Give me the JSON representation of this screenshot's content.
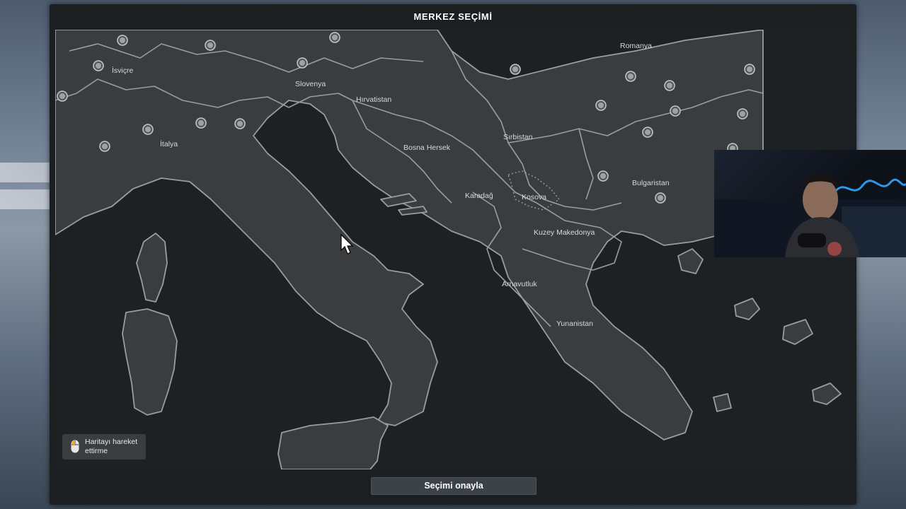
{
  "dialog": {
    "title": "MERKEZ SEÇİMİ",
    "confirm_label": "Seçimi onayla"
  },
  "hint": {
    "text": "Haritayı hareket ettirme",
    "icon": "mouse-icon"
  },
  "countries": {
    "isvicre": "İsviçre",
    "italya": "İtalya",
    "slovenya": "Slovenya",
    "hirvatistan": "Hırvatistan",
    "bosna": "Bosna Hersek",
    "sirbistan": "Sırbistan",
    "romanya": "Romanya",
    "bulgaristan": "Bulgaristan",
    "karadag": "Karadağ",
    "kosova": "Kosova",
    "kuzey_makedonya": "Kuzey Makedonya",
    "arnavutluk": "Arnavutluk",
    "yunanistan": "Yunanistan"
  },
  "colors": {
    "panel": "#1c1f22",
    "land": "#3a3c3e",
    "border": "#9a9da0",
    "city_marker": "#9fa2a5",
    "button": "#3c4249"
  }
}
